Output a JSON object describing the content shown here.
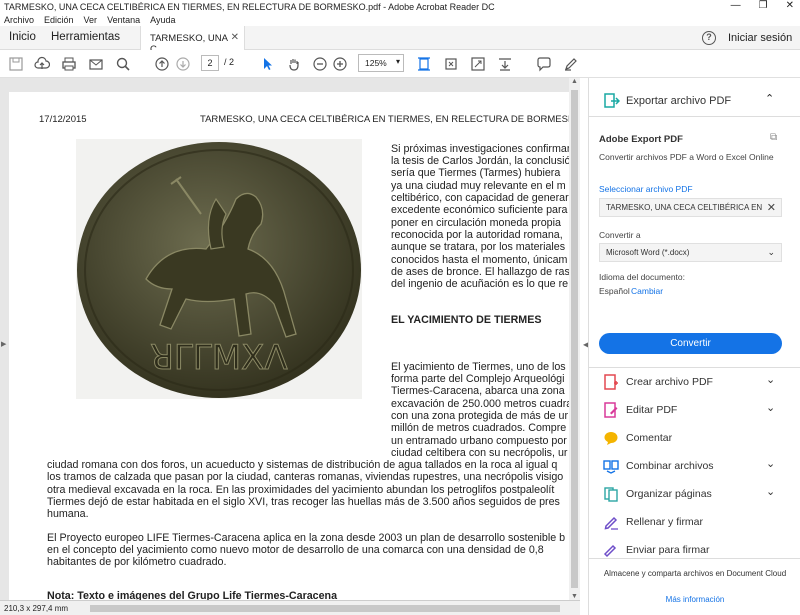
{
  "window": {
    "title": "TARMESKO, UNA CECA CELTIBÉRICA EN TIERMES, EN RELECTURA DE BORMESKO.pdf - Adobe Acrobat Reader DC",
    "controls": [
      "—",
      "❐",
      "✕"
    ]
  },
  "menubar": [
    "Archivo",
    "Edición",
    "Ver",
    "Ventana",
    "Ayuda"
  ],
  "tabs": {
    "home": "Inicio",
    "tools": "Herramientas",
    "document": "TARMESKO, UNA C...",
    "signin": "Iniciar sesión",
    "help": "?"
  },
  "toolbar": {
    "page_current": "2",
    "page_total": "/ 2",
    "zoom": "125%",
    "icons": [
      "save-icon",
      "upload-icon",
      "print-icon",
      "email-icon",
      "search-icon",
      "page-up-icon",
      "page-down-icon",
      "select-cursor-icon",
      "hand-icon",
      "zoom-out-icon",
      "zoom-in-icon",
      "fit-page-icon",
      "rotate-icon",
      "fullscreen-icon",
      "scroll-mode-icon",
      "comment-icon",
      "pen-icon"
    ]
  },
  "document": {
    "date": "17/12/2015",
    "header_title": "TARMESKO, UNA CECA CELTIBÉRICA EN TIERMES, EN RELECTURA DE BORMESKO",
    "right_para_1": [
      "Si próximas investigaciones confirman",
      "la tesis de Carlos Jordán, la conclusión",
      "sería que Tiermes (Tarmes) hubiera",
      "ya una ciudad muy relevante en el m",
      "celtibérico, con capacidad de generar",
      "excedente económico suficiente para",
      "poner en circulación moneda propia",
      "reconocida por la autoridad romana,",
      "aunque se tratara, por los materiales",
      "conocidos hasta el momento, únicam",
      "de ases de bronce. El hallazgo de ras",
      "del ingenio de acuñación es lo que re"
    ],
    "section_heading": "EL YACIMIENTO DE TIERMES",
    "right_para_2": [
      "El yacimiento de Tiermes, uno de los",
      "forma parte del Complejo Arqueológi",
      "Tiermes-Caracena, abarca una zona",
      "excavación de 250.000 metros cuadra",
      "con una zona protegida de más de ur",
      "millón de metros cuadrados. Compre",
      "un entramado urbano compuesto por",
      "ciudad celtibera con su necrópolis, ur"
    ],
    "full_para_1": [
      "ciudad romana con dos foros, un acueducto y sistemas de distribución de agua tallados en la roca al igual q",
      "los tramos de calzada que pasan por la ciudad, canteras romanas, viviendas rupestres, una necrópolis visigo",
      "otra medieval excavada en la roca. En las proximidades del yacimiento abundan los petroglifos postpaleolít",
      "Tiermes dejó de estar habitada en el siglo XVI, tras recoger las huellas más de 3.500 años seguidos de pres",
      "humana."
    ],
    "full_para_2": [
      "El Proyecto europeo LIFE Tiermes-Caracena aplica en la zona desde 2003 un plan de desarrollo sostenible b",
      "en el concepto del yacimiento como nuevo motor de desarrollo de una comarca con una densidad de 0,8",
      "habitantes de por kilómetro cuadrado."
    ],
    "note": "Nota: Texto e imágenes del Grupo Life Tiermes-Caracena",
    "coin_inscription": "ꓤΓΓΜΧΛ"
  },
  "statusbar": {
    "page_size": "210,3 x 297,4 mm"
  },
  "panel": {
    "export_header": "Exportar archivo PDF",
    "title": "Adobe Export PDF",
    "description": "Convertir archivos PDF a Word o Excel Online",
    "select_label": "Seleccionar archivo PDF",
    "file_name": "TARMESKO, UNA CECA CELTIBÉRICA EN",
    "convert_to_label": "Convertir a",
    "format": "Microsoft Word (*.docx)",
    "language_label": "Idioma del documento:",
    "language": "Español",
    "change": "Cambiar",
    "convert_button": "Convertir",
    "tools": [
      {
        "label": "Crear archivo PDF",
        "icon": "create-pdf-icon",
        "color": "#e34850",
        "chevron": "⌄"
      },
      {
        "label": "Editar PDF",
        "icon": "edit-pdf-icon",
        "color": "#d93a9a",
        "chevron": "⌄"
      },
      {
        "label": "Comentar",
        "icon": "comment-icon",
        "color": "#f4b400",
        "chevron": ""
      },
      {
        "label": "Combinar archivos",
        "icon": "combine-files-icon",
        "color": "#1473e6",
        "chevron": "⌄"
      },
      {
        "label": "Organizar páginas",
        "icon": "organize-pages-icon",
        "color": "#2ca6a4",
        "chevron": "⌄"
      },
      {
        "label": "Rellenar y firmar",
        "icon": "fill-sign-icon",
        "color": "#6e4ec9",
        "chevron": ""
      },
      {
        "label": "Enviar para firmar",
        "icon": "send-sign-icon",
        "color": "#6e4ec9",
        "chevron": ""
      }
    ],
    "footer_text": "Almacene y comparta archivos en Document Cloud",
    "footer_link": "Más información"
  },
  "colors": {
    "accent": "#1473e6",
    "export_icon": "#19a9a3"
  }
}
